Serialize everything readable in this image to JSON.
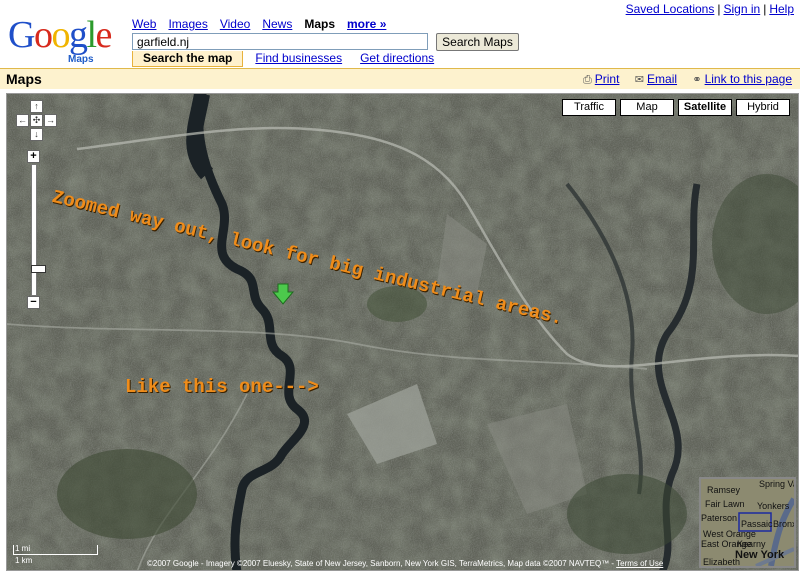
{
  "toplinks": {
    "saved": "Saved Locations",
    "signin": "Sign in",
    "help": "Help",
    "sep": "|"
  },
  "logo": {
    "word": "Google",
    "sub": "Maps"
  },
  "nav": {
    "web": "Web",
    "images": "Images",
    "video": "Video",
    "news": "News",
    "maps": "Maps",
    "more": "more »"
  },
  "search": {
    "value": "garfield.nj",
    "button": "Search Maps"
  },
  "tabs": {
    "search_map": "Search the map",
    "find_businesses": "Find businesses",
    "directions": "Get directions"
  },
  "titlebar": {
    "title": "Maps",
    "print": "Print",
    "email": "Email",
    "link": "Link to this page"
  },
  "map": {
    "types": [
      "Traffic",
      "Map",
      "Satellite",
      "Hybrid"
    ],
    "selected_type": "Satellite",
    "annotation1": "Zoomed way out, look for big industrial areas.",
    "annotation2": "Like this one--->",
    "scale_mi": "1 mi",
    "scale_km": "1 km",
    "copyright": "©2007 Google - Imagery ©2007 Eluesky, State of New Jersey, Sanborn, New York GIS, TerraMetrics, Map data ©2007 NAVTEQ™ - ",
    "terms": "Terms of Use",
    "overview_labels": [
      "Spring Valley",
      "Ramsey",
      "Fair Lawn",
      "Yonkers",
      "Paterson",
      "Passaic",
      "Bronx",
      "West Orange",
      "East Orange",
      "Kearny",
      "New York",
      "Elizabeth"
    ],
    "colors": {
      "annotation": "#ef8c1a",
      "marker": "#4cc94c",
      "river": "#1b2226"
    }
  }
}
